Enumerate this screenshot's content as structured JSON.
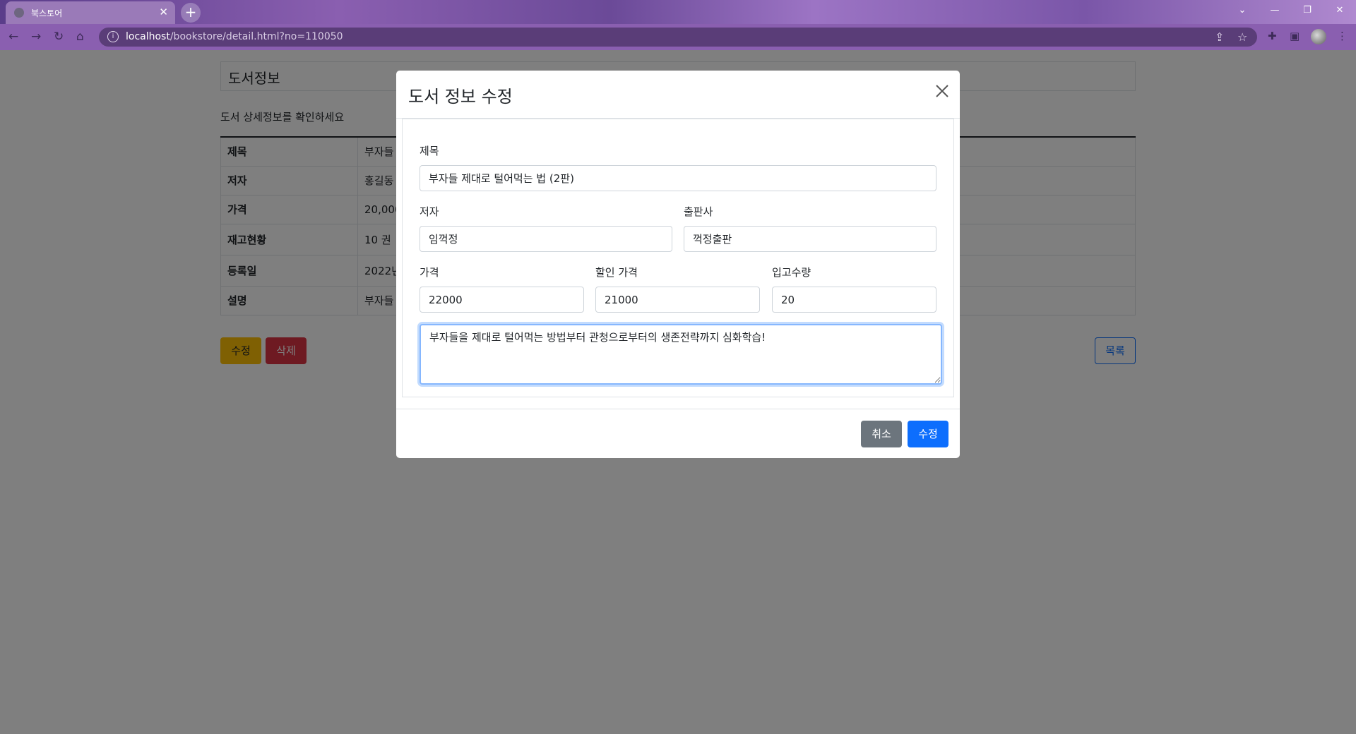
{
  "browser": {
    "tab_title": "북스토어",
    "tab_close": "✕",
    "new_tab": "+",
    "url_host": "localhost",
    "url_path": "/bookstore/detail.html?no=110050",
    "icons": [
      "back-icon",
      "forward-icon",
      "reload-icon",
      "home-icon",
      "info-icon",
      "share-icon",
      "star-icon",
      "extensions-icon",
      "side-panel-icon",
      "profile-avatar"
    ]
  },
  "page": {
    "header": "도서정보",
    "description": "도서 상세정보를 확인하세요",
    "rows": [
      {
        "key": "제목",
        "value": "부자들"
      },
      {
        "key": "저자",
        "value": "홍길동"
      },
      {
        "key": "가격",
        "value": "20,000"
      },
      {
        "key": "재고현황",
        "value": "10 권"
      },
      {
        "key": "등록일",
        "value": "2022년"
      },
      {
        "key": "설명",
        "value": "부자들"
      }
    ],
    "edit_button": "수정",
    "delete_button": "삭제",
    "list_button": "목록"
  },
  "modal": {
    "title": "도서 정보 수정",
    "title_label": "제목",
    "title_value": "부자들 제대로 털어먹는 법 (2판)",
    "author_label": "저자",
    "author_value": "임꺽정",
    "publisher_label": "출판사",
    "publisher_value": "꺽정출판",
    "price_label": "가격",
    "price_value": "22000",
    "discount_label": "할인 가격",
    "discount_value": "21000",
    "stock_label": "입고수량",
    "stock_value": "20",
    "description_value": "부자들을 제대로 털어먹는 방법부터 관청으로부터의 생존전략까지 심화학습!",
    "cancel_button": "취소",
    "submit_button": "수정"
  }
}
